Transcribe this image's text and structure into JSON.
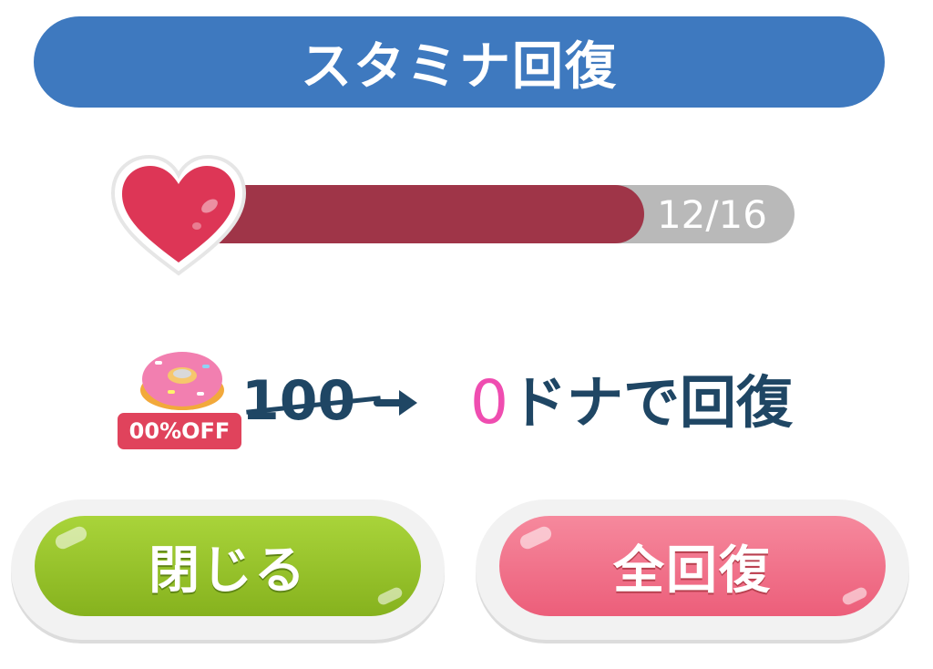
{
  "dialog": {
    "title": "スタミナ回復"
  },
  "stamina": {
    "current": 12,
    "max": 16,
    "label": "12/16",
    "fill_fraction": 0.75,
    "icon": "heart-icon"
  },
  "cost": {
    "item_icon": "donut-icon",
    "discount_badge": "00%OFF",
    "original_price": "100",
    "new_price": "0",
    "text": "ドナで回復"
  },
  "buttons": {
    "close_label": "閉じる",
    "recover_all_label": "全回復"
  },
  "colors": {
    "banner": "#3e79bf",
    "stamina_fill": "#9f3548",
    "stamina_track": "#b9b9b9",
    "close_button": "#97c22a",
    "recover_button": "#ef7089",
    "new_price": "#ef4db0",
    "text_dark": "#1f4664"
  }
}
